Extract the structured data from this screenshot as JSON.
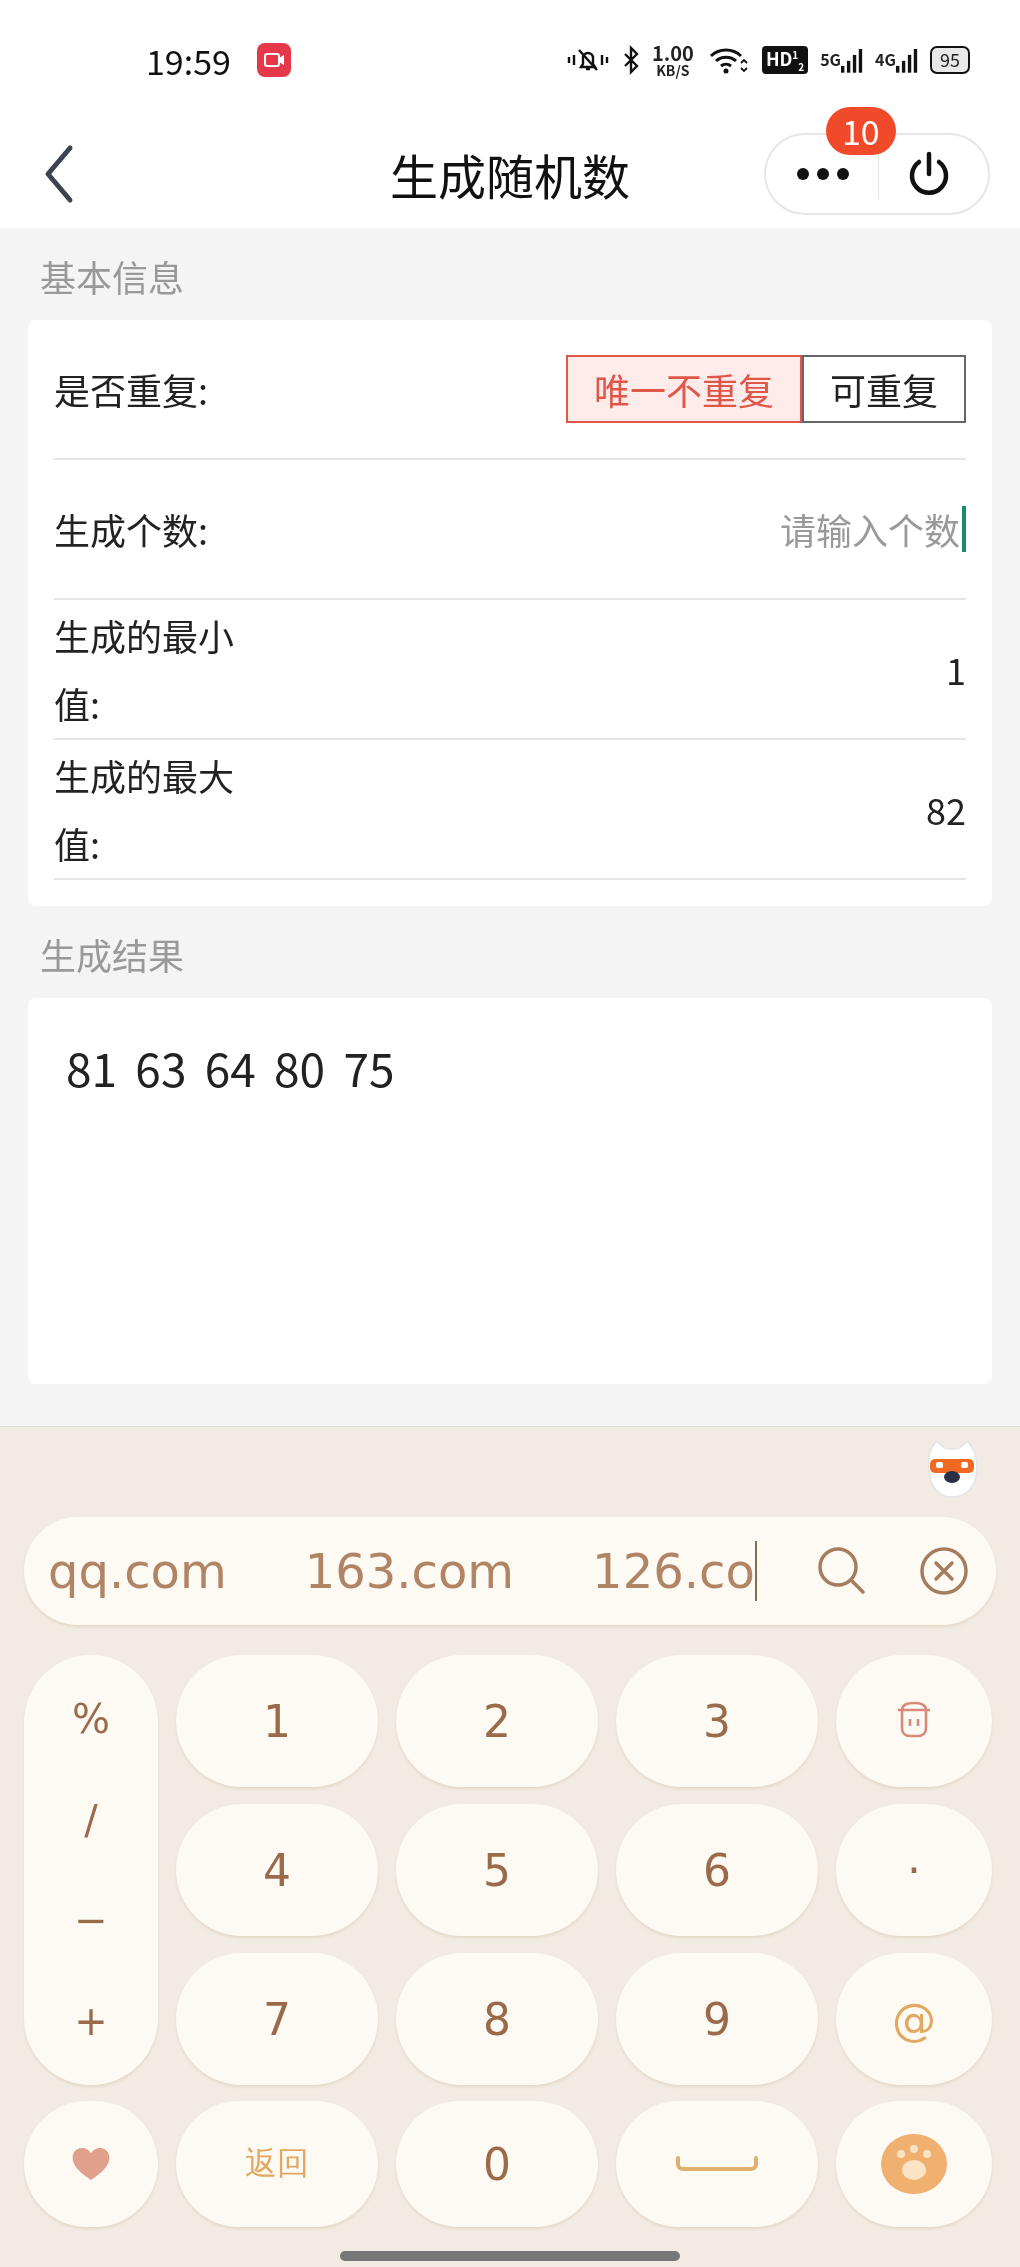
{
  "status_bar": {
    "time": "19:59",
    "speed_value": "1.00",
    "speed_unit": "KB/S",
    "hd_badge": "HD$^{1}$$_{2}$",
    "networks": [
      "5G",
      "4G"
    ],
    "battery": "95"
  },
  "nav_bar": {
    "title": "生成随机数",
    "badge": "10"
  },
  "basic_info": {
    "heading": "基本信息",
    "rows": [
      {
        "kind": "toggle",
        "label": "是否重复:",
        "options": [
          {
            "label": "唯一不重复",
            "selected": true
          },
          {
            "label": "可重复",
            "selected": false
          }
        ]
      },
      {
        "kind": "input",
        "label": "生成个数:",
        "placeholder": "请输入个数",
        "focused": true
      },
      {
        "kind": "value",
        "label": "生成的最小值:",
        "value": "1"
      },
      {
        "kind": "value",
        "label": "生成的最大值:",
        "value": "82"
      }
    ]
  },
  "result": {
    "heading": "生成结果",
    "text": "81 63 64 80 75"
  },
  "keyboard": {
    "suggestions": [
      "qq.com",
      "163.com",
      "126.co"
    ],
    "symbols": [
      "%",
      "/",
      "−",
      "+"
    ],
    "keys": [
      {
        "kind": "text",
        "label": "1"
      },
      {
        "kind": "text",
        "label": "2"
      },
      {
        "kind": "text",
        "label": "3"
      },
      {
        "kind": "delete"
      },
      {
        "kind": "text",
        "label": "4"
      },
      {
        "kind": "text",
        "label": "5"
      },
      {
        "kind": "text",
        "label": "6"
      },
      {
        "kind": "text",
        "label": "·"
      },
      {
        "kind": "text",
        "label": "7"
      },
      {
        "kind": "text",
        "label": "8"
      },
      {
        "kind": "text",
        "label": "9"
      },
      {
        "kind": "accent",
        "label": "@"
      },
      {
        "kind": "heart"
      },
      {
        "kind": "accent",
        "label": "返回"
      },
      {
        "kind": "text",
        "label": "0"
      },
      {
        "kind": "space"
      },
      {
        "kind": "paw"
      }
    ]
  }
}
